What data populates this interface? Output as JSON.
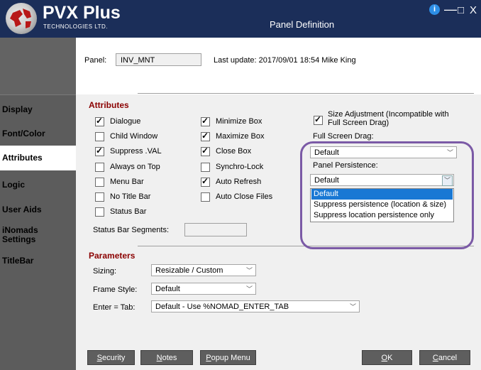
{
  "brand": {
    "name": "PVX Plus",
    "sub": "TECHNOLOGIES LTD."
  },
  "window": {
    "title": "Panel Definition",
    "info_icon": "i",
    "minimize": "—",
    "maximize": "□",
    "close": "X"
  },
  "sidebar": {
    "items": [
      {
        "label": "Display"
      },
      {
        "label": "Font/Color"
      },
      {
        "label": "Attributes",
        "active": true
      },
      {
        "label": "Logic"
      },
      {
        "label": "User Aids"
      },
      {
        "label": "iNomads Settings"
      },
      {
        "label": "TitleBar"
      }
    ]
  },
  "header": {
    "panel_label": "Panel:",
    "panel_value": "INV_MNT",
    "last_update": "Last update: 2017/09/01 18:54 Mike King"
  },
  "attributes": {
    "title": "Attributes",
    "col1": [
      {
        "label": "Dialogue",
        "checked": true
      },
      {
        "label": "Child Window",
        "checked": false
      },
      {
        "label": "Suppress .VAL",
        "checked": true
      },
      {
        "label": "Always on Top",
        "checked": false
      },
      {
        "label": "Menu Bar",
        "checked": false
      },
      {
        "label": "No Title Bar",
        "checked": false
      },
      {
        "label": "Status Bar",
        "checked": false
      }
    ],
    "col2": [
      {
        "label": "Minimize Box",
        "checked": true
      },
      {
        "label": "Maximize Box",
        "checked": true
      },
      {
        "label": "Close Box",
        "checked": true
      },
      {
        "label": "Synchro-Lock",
        "checked": false
      },
      {
        "label": "Auto Refresh",
        "checked": true
      },
      {
        "label": "Auto Close Files",
        "checked": false
      }
    ],
    "size_adjust": {
      "label_line1": "Size Adjustment (Incompatible with",
      "label_line2": "Full Screen Drag)",
      "checked": true
    },
    "full_screen_drag": {
      "label": "Full Screen Drag:",
      "value": "Default"
    },
    "panel_persistence": {
      "label": "Panel Persistence:",
      "value": "Default",
      "options": [
        "Default",
        "Suppress persistence (location & size)",
        "Suppress location persistence only"
      ],
      "selected_index": 0
    },
    "status_bar_segments": {
      "label": "Status Bar Segments:",
      "value": ""
    }
  },
  "parameters": {
    "title": "Parameters",
    "sizing": {
      "label": "Sizing:",
      "value": "Resizable / Custom"
    },
    "frame_style": {
      "label": "Frame Style:",
      "value": "Default"
    },
    "enter_tab": {
      "label": "Enter = Tab:",
      "value": "Default - Use %NOMAD_ENTER_TAB"
    }
  },
  "buttons": {
    "security": {
      "first": "S",
      "rest": "ecurity"
    },
    "notes": {
      "first": "N",
      "rest": "otes"
    },
    "popup": {
      "first": "P",
      "rest": "opup Menu"
    },
    "ok": {
      "first": "O",
      "rest": "K"
    },
    "cancel": {
      "first": "C",
      "rest": "ancel"
    }
  },
  "colors": {
    "title_bar": "#1b2e59",
    "sidebar": "#5c5c5c",
    "section_title": "#8b0000",
    "selection": "#1978d4",
    "highlight": "#7b5aa6"
  }
}
